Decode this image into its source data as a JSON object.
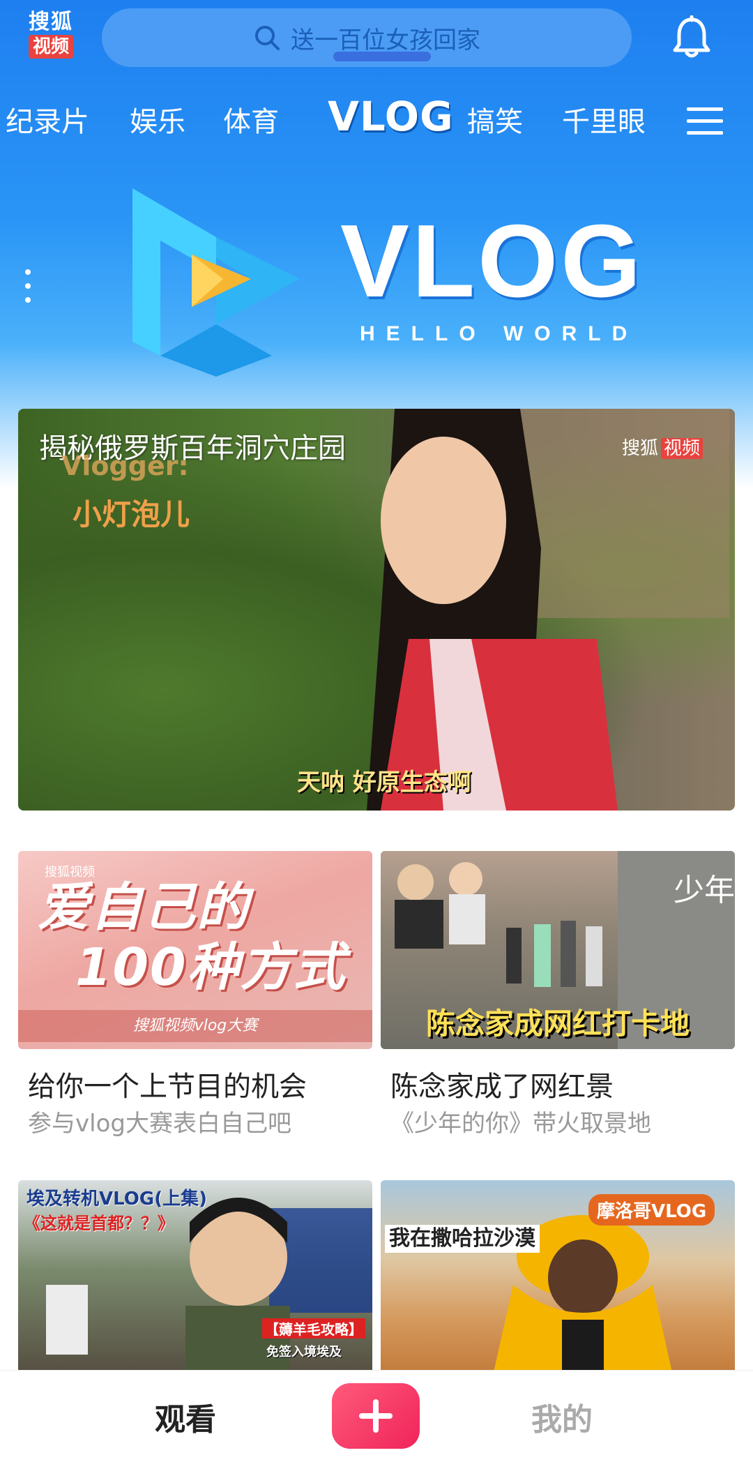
{
  "header": {
    "logo_line1": "搜狐",
    "logo_line2": "视频",
    "search_placeholder": "送一百位女孩回家"
  },
  "tabs": {
    "items": [
      "纪录片",
      "娱乐",
      "体育",
      "VLOG",
      "搞笑",
      "千里眼"
    ],
    "active": "VLOG"
  },
  "banner": {
    "title": "VLOG",
    "subtitle": "HELLO WORLD"
  },
  "feature": {
    "title": "揭秘俄罗斯百年洞穴庄园",
    "watermark_brand": "搜狐",
    "watermark_tag": "视频",
    "overlay_label": "Vlogger:",
    "overlay_name": "小灯泡儿",
    "caption": "天呐 好原生态啊"
  },
  "cards": [
    {
      "title": "给你一个上节目的机会",
      "subtitle": "参与vlog大赛表白自己吧",
      "thumb_text_line1": "爱自己的",
      "thumb_text_line2": "100种方式",
      "thumb_footer": "搜狐视频vlog大赛",
      "thumb_badge": "搜狐视频"
    },
    {
      "title": "陈念家成了网红景",
      "subtitle": "《少年的你》带火取景地",
      "thumb_caption": "陈念家成网红打卡地",
      "thumb_calligraphy": "少年"
    },
    {
      "thumb_line1": "埃及转机VLOG(上集)",
      "thumb_line2": "《这就是首都？？》",
      "thumb_line3": "【薅羊毛攻略】",
      "thumb_line4": "免签入境埃及"
    },
    {
      "thumb_badge": "摩洛哥VLOG",
      "thumb_text": "我在撒哈拉沙漠"
    }
  ],
  "bottom_nav": {
    "watch": "观看",
    "mine": "我的"
  },
  "colors": {
    "brand_blue": "#1e7ff0",
    "brand_red": "#e8433f",
    "plus_pink": "#f0245a"
  }
}
